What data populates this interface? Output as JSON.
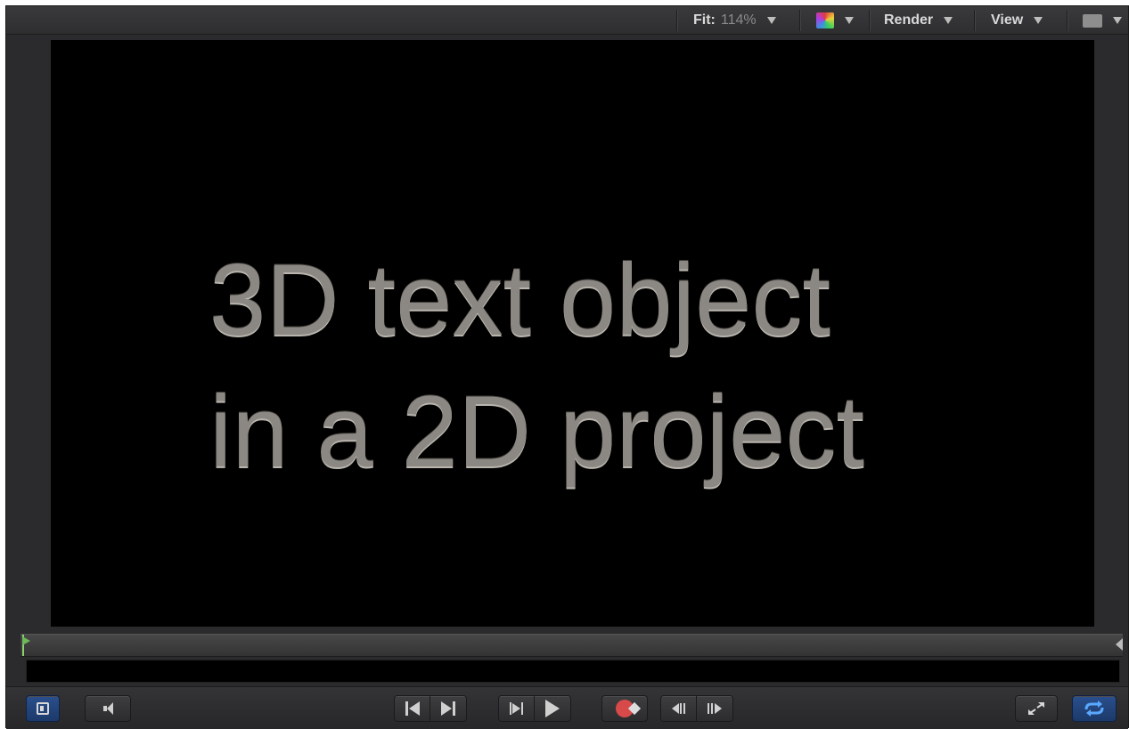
{
  "toolbar": {
    "fit_label": "Fit:",
    "fit_value": "114%",
    "channels_icon": "color-channels-icon",
    "render_label": "Render",
    "view_label": "View",
    "layout_icon": "viewer-layout-icon"
  },
  "canvas": {
    "line1": "3D text object",
    "line2": "in a 2D project",
    "background": "#000000",
    "text_color": "#8b8782"
  },
  "timeline": {
    "playhead_color": "#6fb85a"
  },
  "transport": {
    "buttons": [
      {
        "name": "show-hide-project-pane-icon",
        "active": true
      },
      {
        "name": "audio-mute-icon",
        "active": false
      },
      {
        "name": "go-to-start-icon",
        "active": false
      },
      {
        "name": "go-to-end-icon",
        "active": false
      },
      {
        "name": "play-from-start-icon",
        "active": false
      },
      {
        "name": "play-icon",
        "active": false
      },
      {
        "name": "record-icon",
        "active": false
      },
      {
        "name": "previous-frame-icon",
        "active": false
      },
      {
        "name": "next-frame-icon",
        "active": false
      },
      {
        "name": "fullscreen-icon",
        "active": false
      },
      {
        "name": "loop-playback-icon",
        "active": true
      }
    ],
    "accent_color": "#2a4f8d"
  }
}
